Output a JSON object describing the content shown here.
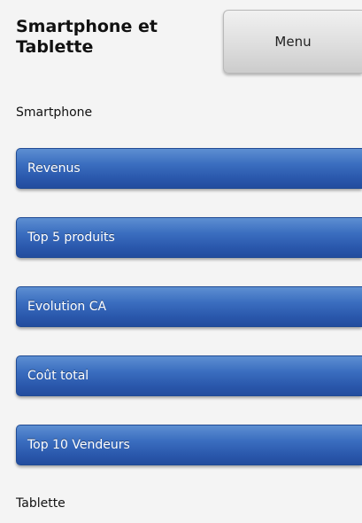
{
  "header": {
    "title": "Smartphone et Tablette",
    "menu_label": "Menu"
  },
  "sections": {
    "smartphone": "Smartphone",
    "tablette": "Tablette"
  },
  "nav_items": [
    {
      "label": "Revenus"
    },
    {
      "label": "Top 5 produits"
    },
    {
      "label": "Evolution CA"
    },
    {
      "label": "Coût total"
    },
    {
      "label": "Top 10 Vendeurs"
    }
  ],
  "colors": {
    "nav_blue": "#2f5fb3",
    "menu_grey": "#dcdcdc",
    "background": "#f4f4f4"
  }
}
